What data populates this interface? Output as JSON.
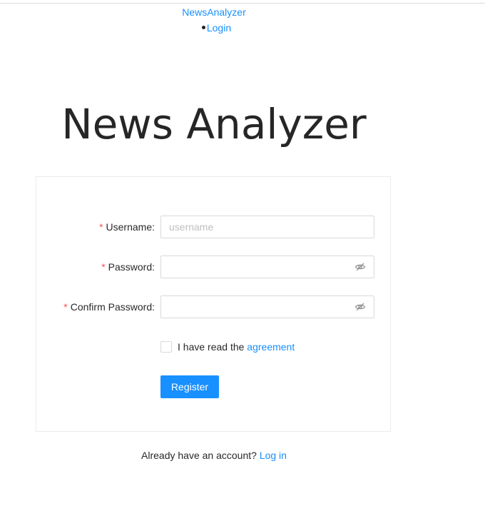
{
  "nav": {
    "brand": "NewsAnalyzer",
    "items": [
      {
        "label": "Login"
      }
    ]
  },
  "page": {
    "title": "News Analyzer"
  },
  "form": {
    "required_mark": "*",
    "username": {
      "label": "Username:",
      "value": "",
      "placeholder": "username"
    },
    "password": {
      "label": "Password:",
      "value": "",
      "placeholder": ""
    },
    "confirm_password": {
      "label": "Confirm Password:",
      "value": "",
      "placeholder": ""
    },
    "agreement": {
      "checked": false,
      "text": "I have read the ",
      "link_label": "agreement"
    },
    "submit_label": "Register"
  },
  "footer": {
    "text": "Already have an account? ",
    "link_label": "Log in"
  },
  "colors": {
    "accent": "#1890ff",
    "required": "#ff4d4f",
    "border": "#d9d9d9"
  },
  "icons": {
    "password_toggle": "eye-invisible-icon",
    "confirm_toggle": "eye-invisible-icon"
  }
}
